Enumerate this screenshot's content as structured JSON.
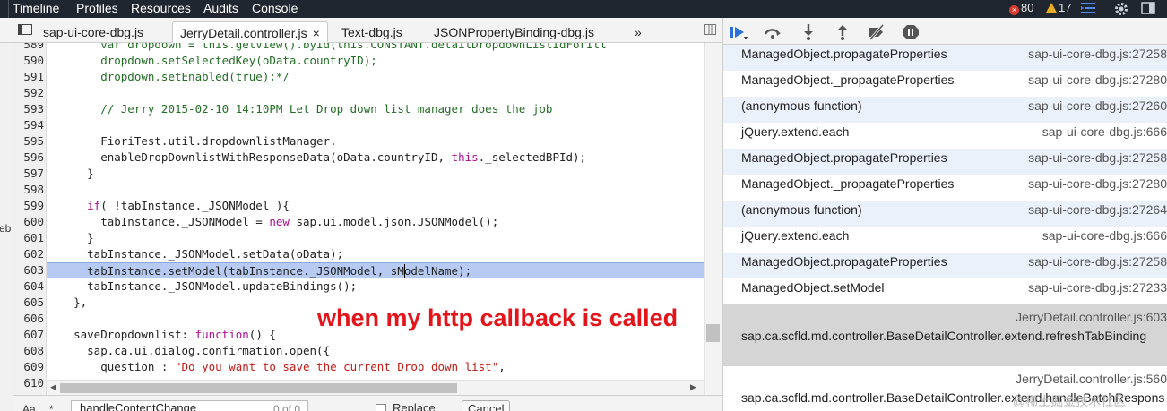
{
  "topbar": {
    "panels": [
      "Timeline",
      "Profiles",
      "Resources",
      "Audits",
      "Console"
    ],
    "error_count": "80",
    "warning_count": "17",
    "error_glyph": "×"
  },
  "tabs": [
    {
      "label": "sap-ui-core-dbg.js",
      "active": false
    },
    {
      "label": "JerryDetail.controller.js",
      "active": true,
      "close": "×"
    },
    {
      "label": "Text-dbg.js",
      "active": false
    },
    {
      "label": "JSONPropertyBinding-dbg.js",
      "active": false
    }
  ],
  "tab_overflow": "»",
  "left_fragment": "eb",
  "code_lines": [
    {
      "n": "589",
      "segments": [
        {
          "t": "        var dropdown = this.getView().byId(this.CONSTANT.detailDropdownListIdForItl",
          "c": "cm"
        }
      ]
    },
    {
      "n": "590",
      "segments": [
        {
          "t": "        dropdown.setSelectedKey(oData.countryID);",
          "c": "cm"
        }
      ]
    },
    {
      "n": "591",
      "segments": [
        {
          "t": "        dropdown.setEnabled(true);*/",
          "c": "cm"
        }
      ]
    },
    {
      "n": "592",
      "segments": [
        {
          "t": "",
          "c": ""
        }
      ]
    },
    {
      "n": "593",
      "segments": [
        {
          "t": "        // Jerry 2015-02-10 14:10PM Let Drop down list manager does the job",
          "c": "cm"
        }
      ]
    },
    {
      "n": "594",
      "segments": [
        {
          "t": "",
          "c": ""
        }
      ]
    },
    {
      "n": "595",
      "segments": [
        {
          "t": "        FioriTest.util.dropdownlistManager.",
          "c": ""
        }
      ]
    },
    {
      "n": "596",
      "segments": [
        {
          "t": "        enableDropDownlistWithResponseData(oData.countryID, ",
          "c": ""
        },
        {
          "t": "this",
          "c": "kw"
        },
        {
          "t": "._selectedBPId);",
          "c": ""
        }
      ]
    },
    {
      "n": "597",
      "segments": [
        {
          "t": "      }",
          "c": ""
        }
      ]
    },
    {
      "n": "598",
      "segments": [
        {
          "t": "",
          "c": ""
        }
      ]
    },
    {
      "n": "599",
      "segments": [
        {
          "t": "      ",
          "c": ""
        },
        {
          "t": "if",
          "c": "kw"
        },
        {
          "t": "( !tabInstance._JSONModel ){",
          "c": ""
        }
      ]
    },
    {
      "n": "600",
      "segments": [
        {
          "t": "        tabInstance._JSONModel = ",
          "c": ""
        },
        {
          "t": "new",
          "c": "kw"
        },
        {
          "t": " sap.ui.model.json.JSONModel();",
          "c": ""
        }
      ]
    },
    {
      "n": "601",
      "segments": [
        {
          "t": "      }",
          "c": ""
        }
      ]
    },
    {
      "n": "602",
      "segments": [
        {
          "t": "      tabInstance._JSONModel.setData(oData);",
          "c": ""
        }
      ]
    },
    {
      "n": "603",
      "segments": [
        {
          "t": "      tabInstance.setModel(tabInstance._JSONModel, sM",
          "c": ""
        },
        {
          "t": "|",
          "c": "caret"
        },
        {
          "t": "odelName);",
          "c": ""
        }
      ],
      "highlight": true
    },
    {
      "n": "604",
      "segments": [
        {
          "t": "      tabInstance._JSONModel.updateBindings();",
          "c": ""
        }
      ]
    },
    {
      "n": "605",
      "segments": [
        {
          "t": "    },",
          "c": ""
        }
      ]
    },
    {
      "n": "606",
      "segments": [
        {
          "t": "",
          "c": ""
        }
      ]
    },
    {
      "n": "607",
      "segments": [
        {
          "t": "    saveDropdownlist: ",
          "c": ""
        },
        {
          "t": "function",
          "c": "kw"
        },
        {
          "t": "() {",
          "c": ""
        }
      ]
    },
    {
      "n": "608",
      "segments": [
        {
          "t": "      sap.ca.ui.dialog.confirmation.open({",
          "c": ""
        }
      ]
    },
    {
      "n": "609",
      "segments": [
        {
          "t": "        question : ",
          "c": ""
        },
        {
          "t": "\"Do you want to save the current Drop down list\"",
          "c": "str"
        },
        {
          "t": ",",
          "c": ""
        }
      ]
    },
    {
      "n": "610",
      "segments": [
        {
          "t": "",
          "c": ""
        }
      ]
    }
  ],
  "annotation": "when my http callback is called",
  "search": {
    "aa_label": "Aa",
    "star": "*",
    "query": "handleContentChange",
    "count": "0 of 0",
    "replace_label": "Replace",
    "cancel_label": "Cancel"
  },
  "call_stack": [
    {
      "fn": "ManagedObject.propagateProperties",
      "loc": "sap-ui-core-dbg.js:27258",
      "bg": "blue"
    },
    {
      "fn": "ManagedObject._propagateProperties",
      "loc": "sap-ui-core-dbg.js:27280",
      "bg": "white"
    },
    {
      "fn": "(anonymous function)",
      "loc": "sap-ui-core-dbg.js:27260",
      "bg": "blue"
    },
    {
      "fn": "jQuery.extend.each",
      "loc": "sap-ui-core-dbg.js:666",
      "bg": "white"
    },
    {
      "fn": "ManagedObject.propagateProperties",
      "loc": "sap-ui-core-dbg.js:27258",
      "bg": "blue"
    },
    {
      "fn": "ManagedObject._propagateProperties",
      "loc": "sap-ui-core-dbg.js:27280",
      "bg": "white"
    },
    {
      "fn": "(anonymous function)",
      "loc": "sap-ui-core-dbg.js:27264",
      "bg": "blue"
    },
    {
      "fn": "jQuery.extend.each",
      "loc": "sap-ui-core-dbg.js:666",
      "bg": "white"
    },
    {
      "fn": "ManagedObject.propagateProperties",
      "loc": "sap-ui-core-dbg.js:27258",
      "bg": "blue"
    },
    {
      "fn": "ManagedObject.setModel",
      "loc": "sap-ui-core-dbg.js:27233",
      "bg": "white"
    },
    {
      "fn": "sap.ca.scfld.md.controller.BaseDetailController.extend.refreshTabBinding",
      "loc": "JerryDetail.controller.js:603",
      "bg": "selected"
    },
    {
      "fn": "sap.ca.scfld.md.controller.BaseDetailController.extend.handleBatchResponses",
      "loc": "JerryDetail.controller.js:560",
      "bg": "white"
    }
  ],
  "watermark": "@稀土掘金技术社区",
  "colors": {
    "annotation": "#e4141b",
    "highlight": "#b7cbf2",
    "keyword": "#aa0d91",
    "string": "#c41a16",
    "comment": "#236e25",
    "frame_blue": "#eaf1fb",
    "frame_selected": "#d5d5d5"
  }
}
